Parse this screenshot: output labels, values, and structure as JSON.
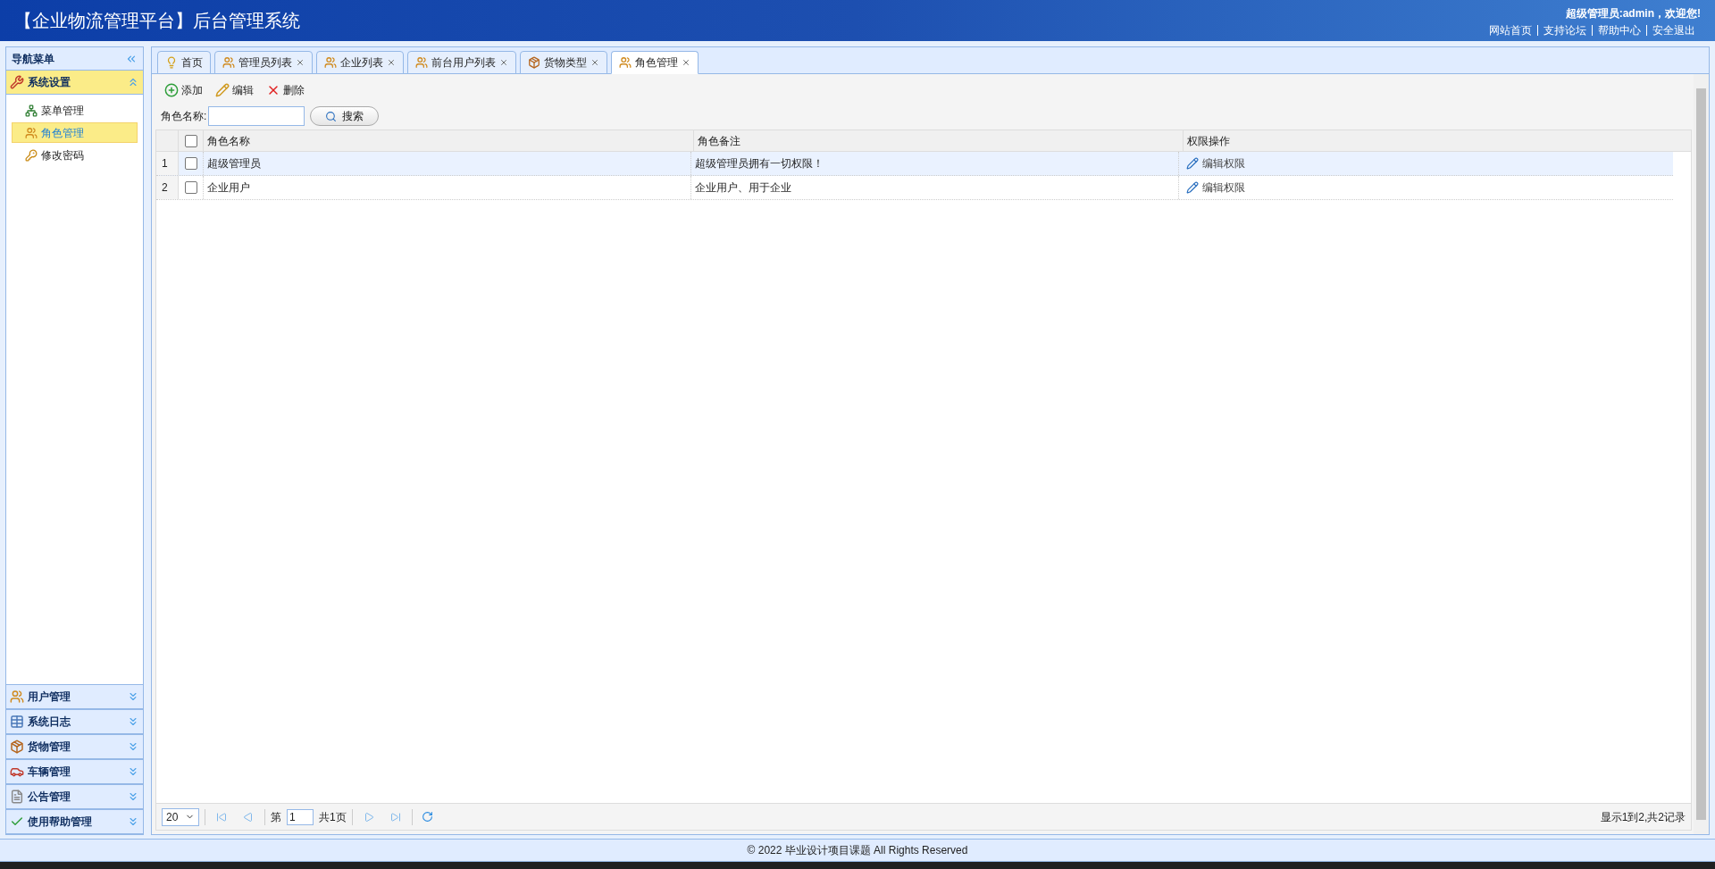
{
  "header": {
    "title": "【企业物流管理平台】后台管理系统",
    "welcome": "超级管理员:admin，欢迎您!",
    "links": [
      "网站首页",
      "支持论坛",
      "帮助中心",
      "安全退出"
    ]
  },
  "sidebar": {
    "title": "导航菜单",
    "sections": [
      {
        "label": "系统设置",
        "expanded": true,
        "items": [
          {
            "label": "菜单管理",
            "selected": false
          },
          {
            "label": "角色管理",
            "selected": true
          },
          {
            "label": "修改密码",
            "selected": false
          }
        ]
      },
      {
        "label": "用户管理",
        "expanded": false
      },
      {
        "label": "系统日志",
        "expanded": false
      },
      {
        "label": "货物管理",
        "expanded": false
      },
      {
        "label": "车辆管理",
        "expanded": false
      },
      {
        "label": "公告管理",
        "expanded": false
      },
      {
        "label": "使用帮助管理",
        "expanded": false
      }
    ]
  },
  "tabs": [
    {
      "label": "首页",
      "closable": false,
      "selected": false
    },
    {
      "label": "管理员列表",
      "closable": true,
      "selected": false
    },
    {
      "label": "企业列表",
      "closable": true,
      "selected": false
    },
    {
      "label": "前台用户列表",
      "closable": true,
      "selected": false
    },
    {
      "label": "货物类型",
      "closable": true,
      "selected": false
    },
    {
      "label": "角色管理",
      "closable": true,
      "selected": true
    }
  ],
  "toolbar": [
    "添加",
    "编辑",
    "删除"
  ],
  "search": {
    "label": "角色名称:",
    "button": "搜索"
  },
  "table": {
    "columns": [
      "角色名称",
      "角色备注",
      "权限操作"
    ],
    "all_checked": false,
    "rows": [
      {
        "index": "1",
        "checked": false,
        "selected": true,
        "name": "超级管理员",
        "note": "超级管理员拥有一切权限！",
        "action": "编辑权限"
      },
      {
        "index": "2",
        "checked": false,
        "selected": false,
        "name": "企业用户",
        "note": "企业用户、用于企业",
        "action": "编辑权限"
      }
    ]
  },
  "pagination": {
    "page_size": "20",
    "page_prefix": "第",
    "page": "1",
    "total": "共1页",
    "summary": "显示1到2,共2记录"
  },
  "footer": "© 2022 毕业设计项目课题 All Rights Reserved"
}
